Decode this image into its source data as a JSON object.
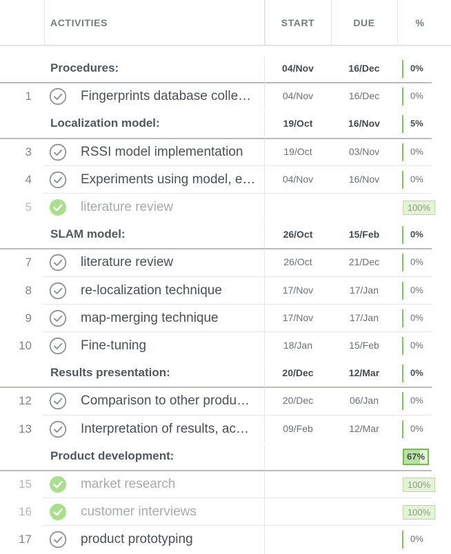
{
  "header": {
    "activities": "ACTIVITIES",
    "start": "START",
    "due": "DUE",
    "percent": "%"
  },
  "groups": [
    {
      "title": "Procedures:",
      "start": "04/Nov",
      "due": "16/Dec",
      "percent": "0%",
      "progress": 0
    },
    {
      "title": "Localization model:",
      "start": "19/Oct",
      "due": "16/Nov",
      "percent": "5%",
      "progress": 0.05
    },
    {
      "title": "SLAM model:",
      "start": "26/Oct",
      "due": "15/Feb",
      "percent": "0%",
      "progress": 0
    },
    {
      "title": "Results presentation:",
      "start": "20/Dec",
      "due": "12/Mar",
      "percent": "0%",
      "progress": 0
    },
    {
      "title": "Product development:",
      "start": "",
      "due": "",
      "percent": "67%",
      "progress": 0.67
    }
  ],
  "tasks": [
    {
      "num": "1",
      "title": "Fingerprints database colle…",
      "start": "04/Nov",
      "due": "16/Dec",
      "percent": "0%",
      "done": false
    },
    {
      "num": "3",
      "title": "RSSI model implementation",
      "start": "19/Oct",
      "due": "03/Nov",
      "percent": "0%",
      "done": false
    },
    {
      "num": "4",
      "title": "Experiments using model, e…",
      "start": "04/Nov",
      "due": "16/Nov",
      "percent": "0%",
      "done": false
    },
    {
      "num": "5",
      "title": "literature review",
      "start": "",
      "due": "",
      "percent": "100%",
      "done": true
    },
    {
      "num": "7",
      "title": "literature review",
      "start": "26/Oct",
      "due": "21/Dec",
      "percent": "0%",
      "done": false
    },
    {
      "num": "8",
      "title": "re-localization technique",
      "start": "17/Nov",
      "due": "17/Jan",
      "percent": "0%",
      "done": false
    },
    {
      "num": "9",
      "title": "map-merging technique",
      "start": "17/Nov",
      "due": "17/Jan",
      "percent": "0%",
      "done": false
    },
    {
      "num": "10",
      "title": "Fine-tuning",
      "start": "18/Jan",
      "due": "15/Feb",
      "percent": "0%",
      "done": false
    },
    {
      "num": "12",
      "title": "Comparison to other produ…",
      "start": "20/Dec",
      "due": "06/Jan",
      "percent": "0%",
      "done": false
    },
    {
      "num": "13",
      "title": "Interpretation of results, ac…",
      "start": "09/Feb",
      "due": "12/Mar",
      "percent": "0%",
      "done": false
    },
    {
      "num": "15",
      "title": "market research",
      "start": "",
      "due": "",
      "percent": "100%",
      "done": true
    },
    {
      "num": "16",
      "title": "customer interviews",
      "start": "",
      "due": "",
      "percent": "100%",
      "done": true
    },
    {
      "num": "17",
      "title": "product prototyping",
      "start": "",
      "due": "",
      "percent": "0%",
      "done": false
    }
  ],
  "colors": {
    "accent_green": "#7cc85a",
    "done_fill": "#e2f3d6",
    "check_grey": "#8e9397"
  }
}
